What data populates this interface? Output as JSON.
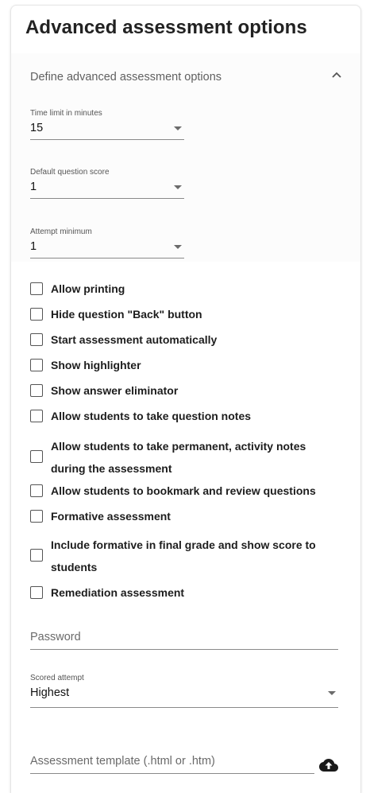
{
  "card": {
    "title": "Advanced assessment options",
    "section_title": "Define advanced assessment options"
  },
  "selects": {
    "time_limit": {
      "label": "Time limit in minutes",
      "value": "15"
    },
    "default_score": {
      "label": "Default question score",
      "value": "1"
    },
    "attempt_minimum": {
      "label": "Attempt minimum",
      "value": "1"
    },
    "scored_attempt": {
      "label": "Scored attempt",
      "value": "Highest"
    }
  },
  "checkboxes": [
    {
      "label": "Allow printing",
      "checked": false
    },
    {
      "label": "Hide question \"Back\" button",
      "checked": false
    },
    {
      "label": "Start assessment automatically",
      "checked": false
    },
    {
      "label": "Show highlighter",
      "checked": false
    },
    {
      "label": "Show answer eliminator",
      "checked": false
    },
    {
      "label": "Allow students to take question notes",
      "checked": false
    },
    {
      "label": "Allow students to take permanent, activity notes during the assessment",
      "checked": false
    },
    {
      "label": "Allow students to bookmark and review questions",
      "checked": false
    },
    {
      "label": "Formative assessment",
      "checked": false
    },
    {
      "label": "Include formative in final grade and show score to students",
      "checked": false
    },
    {
      "label": "Remediation assessment",
      "checked": false
    }
  ],
  "password": {
    "placeholder": "Password"
  },
  "template": {
    "placeholder": "Assessment template (.html or .htm)"
  },
  "icons": {
    "collapse": "chevron-up-icon",
    "dropdown": "caret-down-icon",
    "upload": "cloud-upload-icon"
  },
  "colors": {
    "text": "#212121",
    "muted": "#606060",
    "underline": "#8a8a8a"
  }
}
